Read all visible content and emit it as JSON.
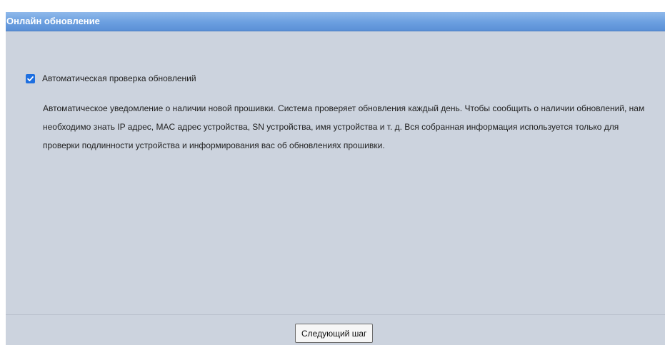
{
  "header": {
    "title": "Онлайн обновление"
  },
  "auto_check": {
    "checked": true,
    "label": "Автоматическая проверка обновлений",
    "description": "Автоматическое уведомление о наличии новой прошивки. Система проверяет обновления каждый день. Чтобы сообщить о наличии обновлений, нам необходимо знать IP адрес, MAC адрес устройства, SN устройства, имя устройства и т. д. Вся собранная информация используется только для проверки подлинности устройства и информирования вас об обновлениях прошивки."
  },
  "footer": {
    "next_button_label": "Следующий шаг"
  },
  "colors": {
    "panel_background": "#ccd3de",
    "title_bar": "#6b9fe0",
    "checkbox_accent": "#1e6fe0"
  },
  "icons": {
    "checkbox": "checkmark-icon"
  }
}
